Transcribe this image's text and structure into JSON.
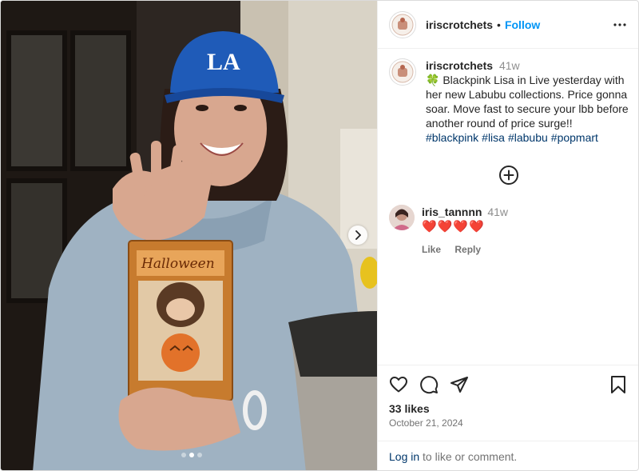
{
  "post": {
    "username": "iriscrotchets",
    "follow_label": "Follow",
    "separator": "•",
    "caption": {
      "username": "iriscrotchets",
      "time": "41w",
      "emoji": "🍀",
      "text": "Blackpink Lisa in Live yesterday with her new Labubu collections. Price gonna soar. Move fast to secure your lbb before another round of price surge!!",
      "hashtags": [
        "#blackpink",
        "#lisa",
        "#labubu",
        "#popmart"
      ]
    },
    "comments": [
      {
        "username": "iris_tannnn",
        "time": "41w",
        "text": "❤️❤️❤️❤️",
        "like_label": "Like",
        "reply_label": "Reply"
      }
    ],
    "likes": "33 likes",
    "date": "October 21, 2024",
    "login": {
      "link": "Log in",
      "text": "to like or comment."
    },
    "carousel": {
      "count": 3,
      "active": 2
    }
  },
  "icons": {
    "more": "more-options-icon",
    "add_comment": "plus-circle-icon",
    "like": "heart-icon",
    "comment": "comment-icon",
    "share": "share-icon",
    "save": "bookmark-icon",
    "next": "chevron-right-icon"
  },
  "colors": {
    "link": "#0095f6",
    "hashtag": "#00376b",
    "muted": "#737373",
    "heart": "#e0245e"
  }
}
